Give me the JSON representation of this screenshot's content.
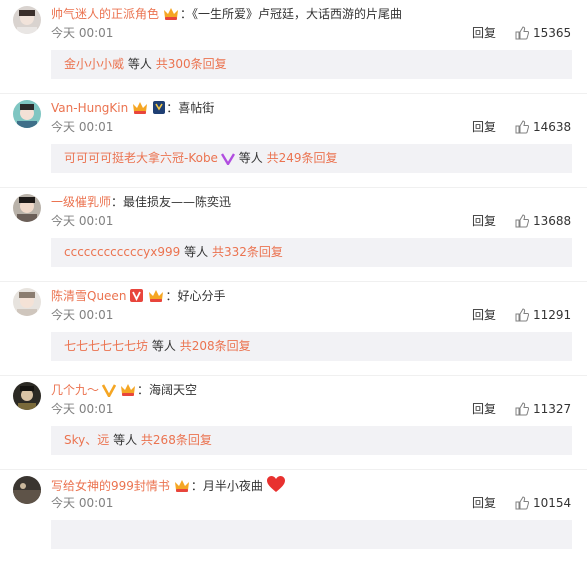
{
  "colors": {
    "link": "#eb7350",
    "text": "#333333",
    "muted": "#808080",
    "sub_bg": "#f2f2f5"
  },
  "comments": [
    {
      "user": "帅气迷人的正派角色",
      "badges": [
        "crown-vip-icon"
      ],
      "sep": "：",
      "text": "《一生所爱》卢冠廷，大话西游的片尾曲",
      "time": "今天 00:01",
      "reply_label": "回复",
      "likes": "15365",
      "sub_names": "金小小小威",
      "sub_etc": "等人",
      "sub_total": "共300条回复"
    },
    {
      "user": "Van-HungKin",
      "badges": [
        "crown-vip-icon",
        "fan-badge-icon"
      ],
      "sep": "：",
      "text": "喜帖街",
      "time": "今天 00:01",
      "reply_label": "回复",
      "likes": "14638",
      "sub_names": "可可可可挺老大拿六冠-Kobe",
      "sub_etc": "等人",
      "sub_total": "共249条回复"
    },
    {
      "user": "一级催乳师",
      "badges": [],
      "sep": "：",
      "text": "最佳损友——陈奕迅",
      "time": "今天 00:01",
      "reply_label": "回复",
      "likes": "13688",
      "sub_names": "ccccccccccccyx999",
      "sub_etc": "等人",
      "sub_total": "共332条回复"
    },
    {
      "user": "陈清雪Queen",
      "badges": [
        "verified-v-icon",
        "crown-vip-icon"
      ],
      "sep": "：",
      "text": "好心分手",
      "time": "今天 00:01",
      "reply_label": "回复",
      "likes": "11291",
      "sub_names": "七七七七七七坊",
      "sub_etc": "等人",
      "sub_total": "共208条回复"
    },
    {
      "user": "几个九～",
      "badges": [
        "verified-v-icon",
        "crown-vip-icon"
      ],
      "sep": "：",
      "text": "海阔天空",
      "time": "今天 00:01",
      "reply_label": "回复",
      "likes": "11327",
      "sub_names": "Sky、远",
      "sub_etc": "等人",
      "sub_total": "共268条回复"
    },
    {
      "user": "写给女神的999封情书",
      "badges": [
        "crown-vip-icon"
      ],
      "sep": "：",
      "text": "月半小夜曲",
      "text_emoji": "heart-emoji-icon",
      "time": "今天 00:01",
      "reply_label": "回复",
      "likes": "10154",
      "sub_names": "",
      "sub_etc": "",
      "sub_total": ""
    }
  ]
}
